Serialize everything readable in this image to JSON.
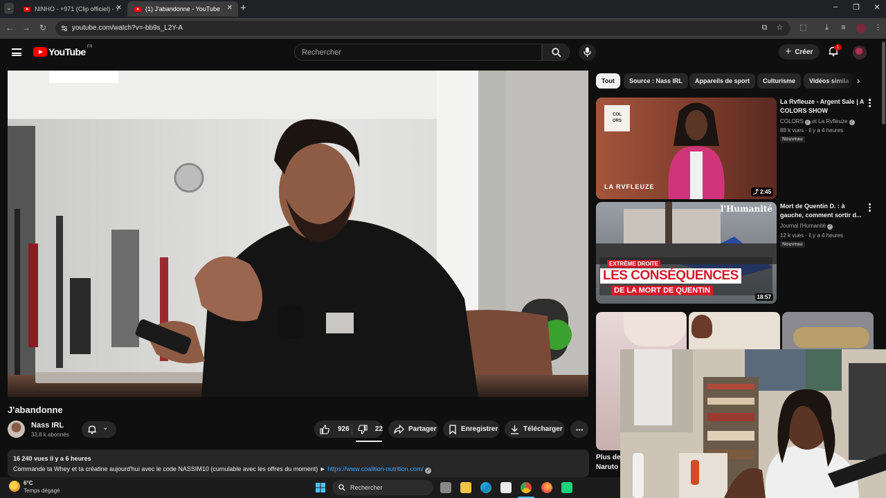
{
  "browser": {
    "tabs": [
      {
        "title": "NINHO - +971 (Clip officiel) - Y",
        "active": false
      },
      {
        "title": "(1) J'abandonne - YouTube",
        "active": true
      }
    ],
    "new_tab": "+",
    "url": "youtube.com/watch?v=-bb9s_L2Y-A"
  },
  "youtube": {
    "logo_text": "YouTube",
    "region": "FR",
    "search_placeholder": "Rechercher",
    "create_label": "Créer",
    "notification_count": "1"
  },
  "video": {
    "title": "J'abandonne",
    "channel": {
      "name": "Nass IRL",
      "subscribers": "33,8 k abonnés"
    },
    "likes": "926",
    "dislikes": "22",
    "share_label": "Partager",
    "save_label": "Enregistrer",
    "download_label": "Télécharger",
    "description": {
      "meta": "16 240 vues  il y a 6 heures",
      "text": "Commande ta Whey et ta créatine aujourd'hui avec le code NASSIM10 (cumulable avec les offres du moment) ► ",
      "link": "https://www.coalition-nutrition.com/"
    }
  },
  "chips": [
    "Tout",
    "Source : Nass IRL",
    "Appareils de sport",
    "Culturisme",
    "Vidéos simila"
  ],
  "recommendations": [
    {
      "title": "La Rvfleuze - Argent Sale | A COLORS SHOW",
      "channel": "COLORS",
      "channel_suffix": "et La Rvfleuze",
      "meta": "88 k vues · il y a 4 heures",
      "badge": "Nouveau",
      "duration": "2:45",
      "thumb_logo_l1": "COL",
      "thumb_logo_l2": "ORS",
      "thumb_caption": "LA RVFLEUZE"
    },
    {
      "title": "Mort de Quentin D. : à gauche, comment sortir d...",
      "channel": "Journal l'Humanité",
      "meta": "12 k vues · il y a 4 heures",
      "badge": "Nouveau",
      "duration": "18:57",
      "thumb_brand": "l'Humanité",
      "thumb_tag": "EXTRÊME DROITE",
      "thumb_headline_1": "LES CONSÉQUENCES",
      "thumb_headline_2": "DE LA MORT DE QUENTIN"
    }
  ],
  "shorts_label": "Plus de",
  "shorts_label_2": "Naruto",
  "taskbar": {
    "temperature": "6°C",
    "weather": "Temps dégagé",
    "search": "Rechercher"
  }
}
